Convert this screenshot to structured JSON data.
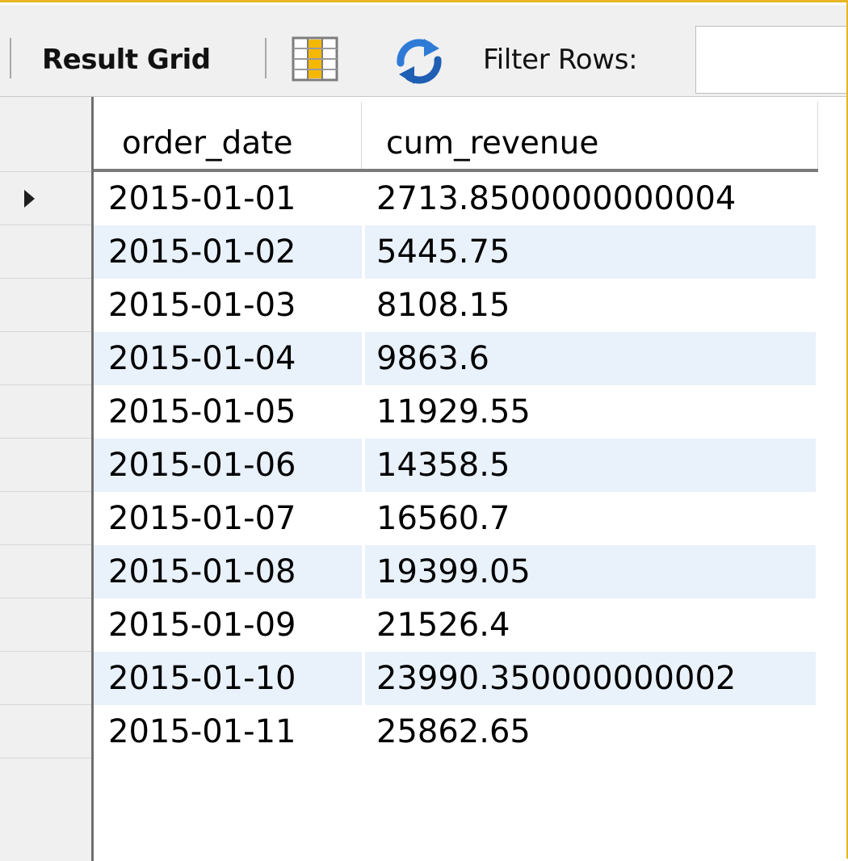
{
  "toolbar": {
    "result_grid_label": "Result Grid",
    "filter_rows_label": "Filter Rows:",
    "filter_value": "",
    "colors": {
      "background": "#f0f0f0",
      "window_border": "#e8b622"
    },
    "icons": {
      "column_layout": "column-layout-icon",
      "refresh": "refresh-icon"
    }
  },
  "grid": {
    "columns": [
      "order_date",
      "cum_revenue"
    ],
    "rows": [
      [
        "2015-01-01",
        "2713.8500000000004"
      ],
      [
        "2015-01-02",
        "5445.75"
      ],
      [
        "2015-01-03",
        "8108.15"
      ],
      [
        "2015-01-04",
        "9863.6"
      ],
      [
        "2015-01-05",
        "11929.55"
      ],
      [
        "2015-01-06",
        "14358.5"
      ],
      [
        "2015-01-07",
        "16560.7"
      ],
      [
        "2015-01-08",
        "19399.05"
      ],
      [
        "2015-01-09",
        "21526.4"
      ],
      [
        "2015-01-10",
        "23990.350000000002"
      ],
      [
        "2015-01-11",
        "25862.65"
      ]
    ],
    "current_row": 0,
    "colors": {
      "alt_row": "#e9f1fb",
      "gutter": "#f0f0f0"
    }
  }
}
